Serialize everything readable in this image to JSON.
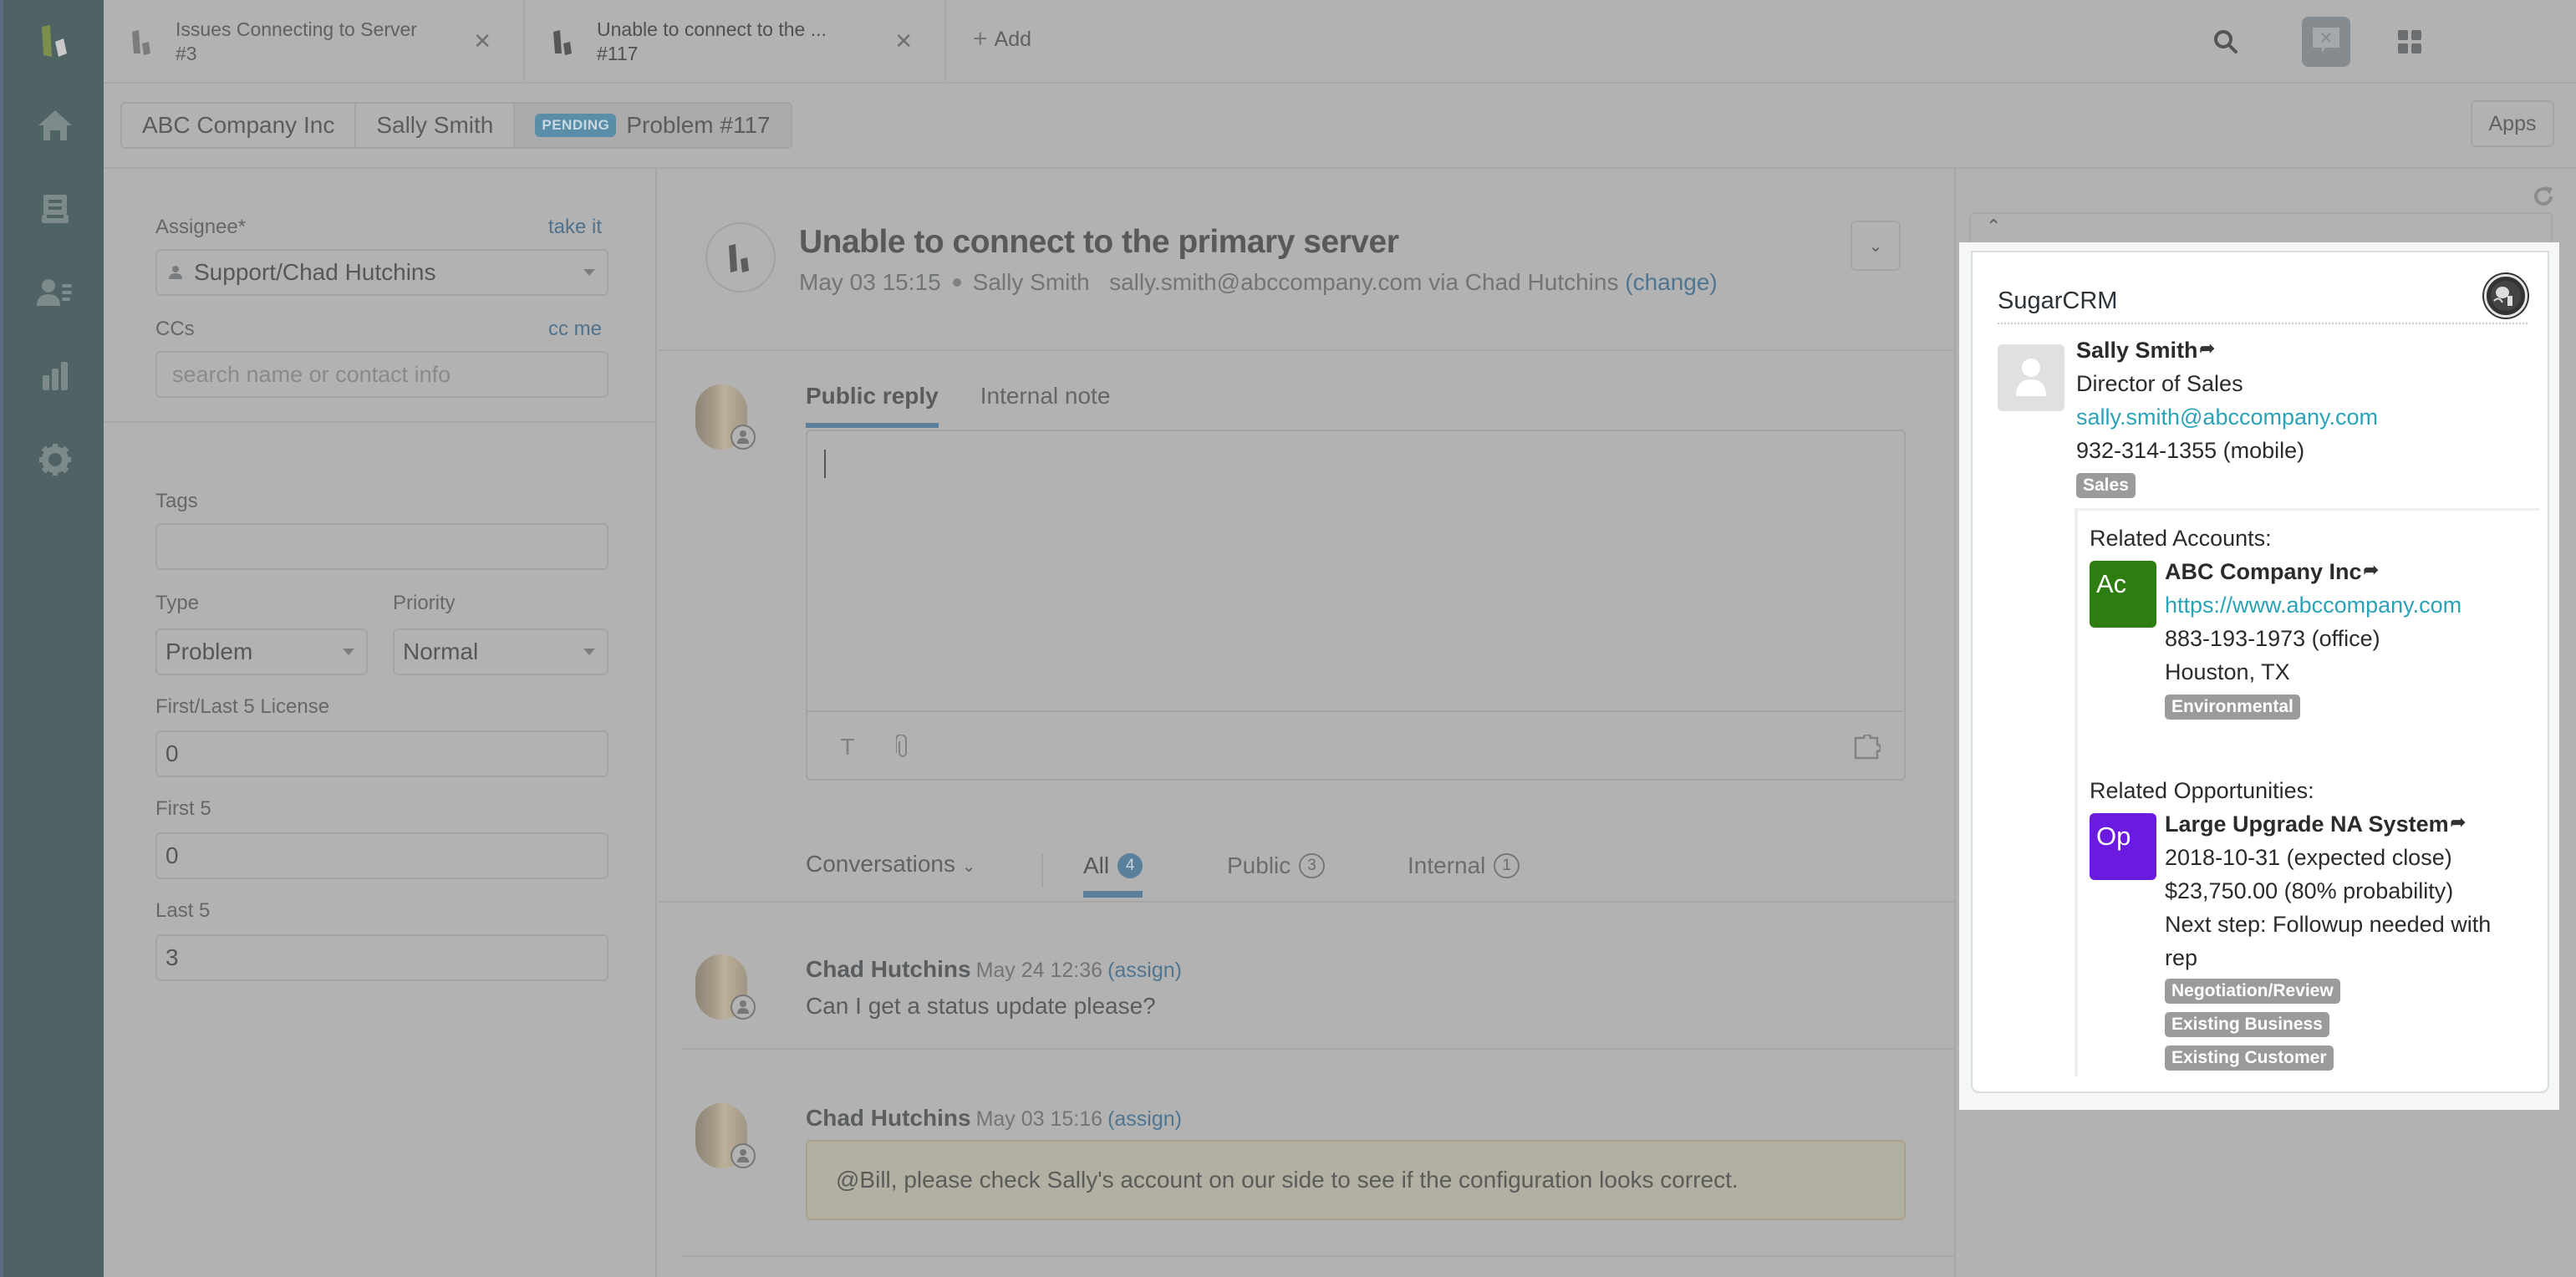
{
  "nav": {
    "items": [
      {
        "name": "home",
        "icon": "home-icon"
      },
      {
        "name": "views",
        "icon": "inbox-icon"
      },
      {
        "name": "customers",
        "icon": "contacts-icon"
      },
      {
        "name": "reporting",
        "icon": "bar-chart-icon"
      },
      {
        "name": "admin",
        "icon": "gear-icon"
      }
    ]
  },
  "tabs": [
    {
      "title": "Issues Connecting to Server",
      "subtitle": "#3",
      "active": false
    },
    {
      "title": "Unable to connect to the ...",
      "subtitle": "#117",
      "active": true
    }
  ],
  "add_tab_label": "Add",
  "breadcrumb": {
    "org": "ABC Company Inc",
    "requester": "Sally Smith",
    "status_badge": "PENDING",
    "ticket": "Problem #117"
  },
  "apps_button": "Apps",
  "properties": {
    "assignee": {
      "label": "Assignee*",
      "action": "take it",
      "value": "Support/Chad Hutchins"
    },
    "ccs": {
      "label": "CCs",
      "action": "cc me",
      "placeholder": "search name or contact info"
    },
    "tags": {
      "label": "Tags",
      "value": ""
    },
    "type": {
      "label": "Type",
      "value": "Problem"
    },
    "priority": {
      "label": "Priority",
      "value": "Normal"
    },
    "first_last_license": {
      "label": "First/Last 5 License",
      "value": "0"
    },
    "first5": {
      "label": "First 5",
      "value": "0"
    },
    "last5": {
      "label": "Last 5",
      "value": "3"
    }
  },
  "ticket": {
    "title": "Unable to connect to the primary server",
    "date": "May 03 15:15",
    "requester": "Sally Smith",
    "via": "sally.smith@abccompany.com via Chad Hutchins",
    "change_label": "(change)"
  },
  "composer": {
    "tabs": [
      "Public reply",
      "Internal note"
    ],
    "active_tab": "Public reply",
    "value": ""
  },
  "conversations": {
    "filter_label": "Conversations",
    "tabs": [
      {
        "label": "All",
        "count": "4",
        "active": true
      },
      {
        "label": "Public",
        "count": "3",
        "active": false
      },
      {
        "label": "Internal",
        "count": "1",
        "active": false
      }
    ]
  },
  "comments": [
    {
      "author": "Chad Hutchins",
      "time": "May 24 12:36",
      "assign": "(assign)",
      "body": "Can I get a status update please?",
      "internal": false
    },
    {
      "author": "Chad Hutchins",
      "time": "May 03 15:16",
      "assign": "(assign)",
      "body": "@Bill, please check Sally's account on our side to see if the configuration looks correct.",
      "internal": true
    }
  ],
  "sugarcrm": {
    "title": "SugarCRM",
    "contact": {
      "name": "Sally Smith",
      "title": "Director of Sales",
      "email": "sally.smith@abccompany.com",
      "phone": "932-314-1355 (mobile)",
      "tag": "Sales"
    },
    "related_accounts_label": "Related Accounts:",
    "account": {
      "icon_text": "Ac",
      "icon_color": "#2e7d10",
      "name": "ABC Company Inc",
      "url": "https://www.abccompany.com",
      "phone": "883-193-1973 (office)",
      "location": "Houston, TX",
      "tag": "Environmental"
    },
    "related_opportunities_label": "Related Opportunities:",
    "opportunity": {
      "icon_text": "Op",
      "icon_color": "#6b1ae0",
      "name": "Large Upgrade NA System",
      "close": "2018-10-31 (expected close)",
      "amount": "$23,750.00 (80% probability)",
      "next_step_line1": "Next step: Followup needed with",
      "next_step_line2": "rep",
      "tags": [
        "Negotiation/Review",
        "Existing Business",
        "Existing Customer"
      ]
    }
  },
  "colors": {
    "accent": "#5b7e9a",
    "link": "#2aa3b7",
    "nav_bg": "#4f6264",
    "overlay_bg": "#b2b2b2"
  }
}
